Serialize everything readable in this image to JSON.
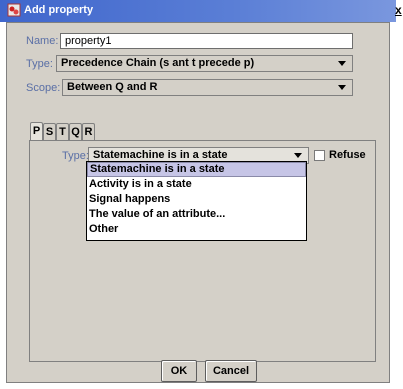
{
  "window": {
    "title": "Add property",
    "close": "x"
  },
  "form": {
    "name_label": "Name:",
    "name_value": "property1",
    "type_label": "Type:",
    "type_value": "Precedence Chain (s ant t precede p)",
    "scope_label": "Scope:",
    "scope_value": "Between Q and R"
  },
  "tabs": [
    "P",
    "S",
    "T",
    "Q",
    "R"
  ],
  "panel": {
    "type_label": "Type:",
    "type_value": "Statemachine is in a state",
    "refuse_label": "Refuse",
    "options": [
      "Statemachine is in a state",
      "Activity is in a state",
      "Signal happens",
      "The value of an attribute...",
      "Other"
    ]
  },
  "buttons": {
    "ok": "OK",
    "cancel": "Cancel"
  }
}
